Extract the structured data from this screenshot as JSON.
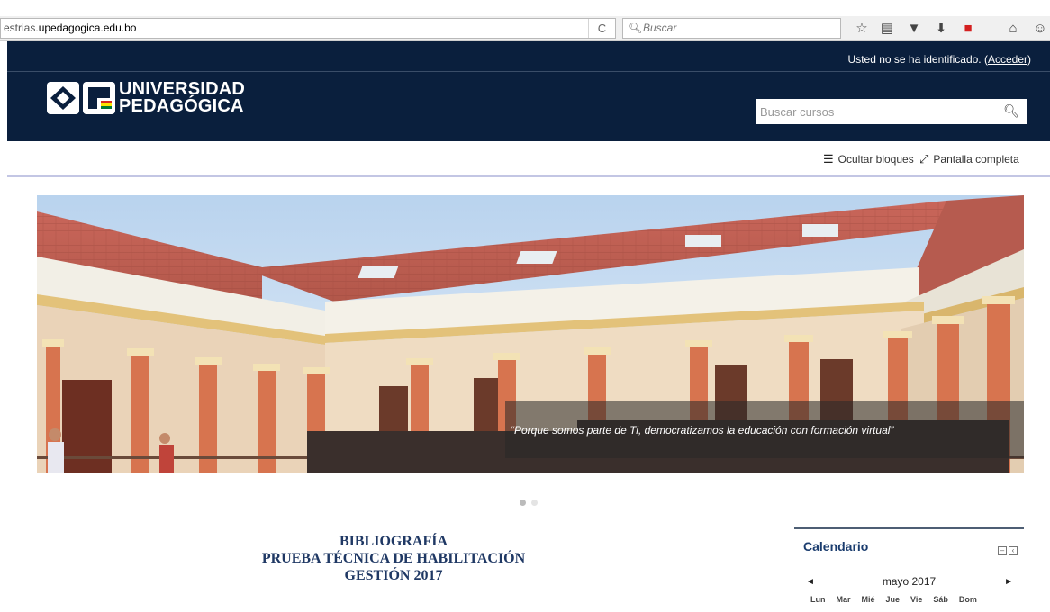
{
  "browser": {
    "url_prefix": "estrias.",
    "url_host": "upedagogica.edu.bo",
    "reload_symbol": "C",
    "search_placeholder": "Buscar"
  },
  "header": {
    "login_text": "Usted no se ha identificado. (",
    "login_link": "Acceder",
    "login_close": ")",
    "logo_line1": "UNIVERSIDAD",
    "logo_line2": "PEDAGÓGICA",
    "course_search_placeholder": "Buscar cursos"
  },
  "controls": {
    "hide_blocks": "Ocultar bloques",
    "fullscreen": "Pantalla completa"
  },
  "slider": {
    "caption": "“Porque somos  parte  de Ti,  democratizamos  la educación con formación virtual”",
    "slide_count": 2,
    "active_slide": 1
  },
  "main": {
    "heading_line1": "BIBLIOGRAFÍA",
    "heading_line2": "PRUEBA TÉCNICA DE HABILITACIÓN",
    "heading_line3": "GESTIÓN 2017"
  },
  "calendar": {
    "title": "Calendario",
    "month": "mayo 2017",
    "prev": "◄",
    "next": "►",
    "days": [
      "Lun",
      "Mar",
      "Mié",
      "Jue",
      "Vie",
      "Sáb",
      "Dom"
    ]
  },
  "colors": {
    "header_bg": "#0a1f3d",
    "accent": "#1a3c6e"
  }
}
